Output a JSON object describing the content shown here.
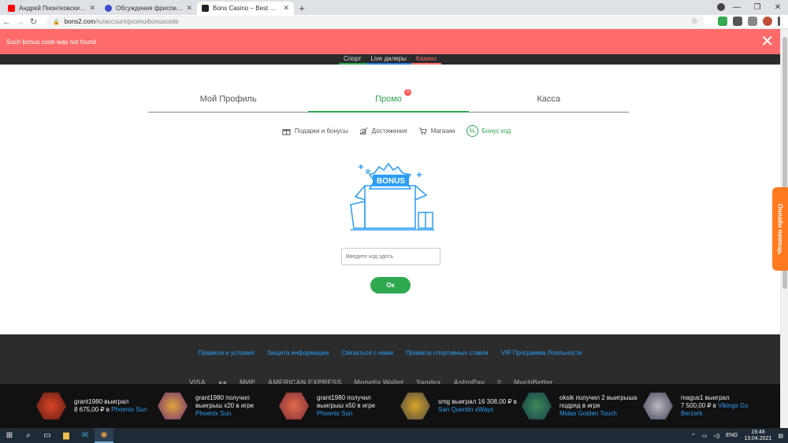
{
  "browser": {
    "tabs": [
      {
        "title": "Андрей Пионтковский - Путин",
        "favicon_color": "#ff0000",
        "active": false
      },
      {
        "title": "Обсуждения фриспинов, промо",
        "favicon_color": "#3b4cca",
        "active": false
      },
      {
        "title": "Bons Casino – Best Online Casino",
        "favicon_color": "#222222",
        "active": true
      }
    ],
    "new_tab": "+",
    "url_host": "bons2.com",
    "url_path": "/ru/account/promo/bonuscode"
  },
  "notification": {
    "message": "Such bonus code was not found",
    "close": "✕"
  },
  "topnav": {
    "sport": "Спорт",
    "live": "Live дилеры",
    "casino": "Казино"
  },
  "profile_tabs": {
    "profile": "Мой Профиль",
    "promo": "Промо",
    "promo_badge": "5",
    "cashier": "Касса"
  },
  "subnav": {
    "gifts": "Подарки и бонусы",
    "achievements": "Достижения",
    "shop": "Магазин",
    "bonus_code": "Бонус код"
  },
  "bonus_form": {
    "illustration_label": "BONUS",
    "placeholder": "Введите код здесь",
    "ok_label": "Ок"
  },
  "help_tab": "Онлайн помощь",
  "footer": {
    "links": [
      "Правила и условия",
      "Защита информации",
      "Связаться с нами",
      "Правила спортивных ставок",
      "VIP Программа Лояльности"
    ],
    "payments": [
      "VISA",
      "●●",
      "МИР",
      "AMERICAN EXPRESS",
      "Monetix Wallet",
      "Yandex",
      "AstroPay",
      "▯",
      "MuchBetter"
    ]
  },
  "winners": [
    {
      "line1": "grant1980 выиграл",
      "line2": "8 675,00 ₽ в ",
      "game": "Phoenix Sun",
      "color": "#8b2a1a"
    },
    {
      "line1": "grant1980 получил",
      "line2": "выигрыш x20 в игре",
      "game": "Phoenix Sun",
      "color": "#6a2a7a"
    },
    {
      "line1": "grant1980 получил",
      "line2": "выигрыш x50 в игре",
      "game": "Phoenix Sun",
      "color": "#7a2a3a"
    },
    {
      "line1": "smg выиграл 16 308,00 ₽ в",
      "line2": "",
      "game": "San Quentin xWays",
      "color": "#555555"
    },
    {
      "line1": "oksik получил 2 выигрыша",
      "line2": "подряд в игре ",
      "game": "Midas Golden Touch",
      "color": "#1a3a4a"
    },
    {
      "line1": "magus1 выиграл",
      "line2": "7 500,00 ₽ в ",
      "game": "Vikings Go Berzerk",
      "color": "#3a3a5a"
    }
  ],
  "taskbar": {
    "lang": "ENG",
    "time": "19:48",
    "date": "13.04.2021"
  }
}
